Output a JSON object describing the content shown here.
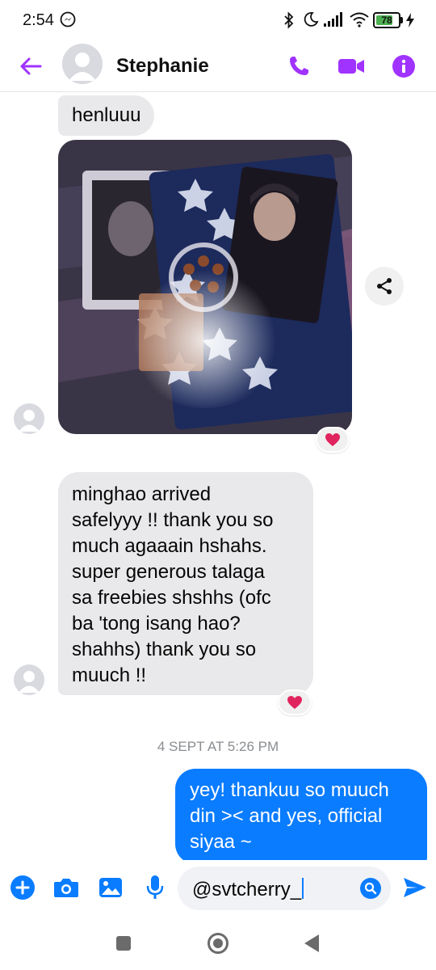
{
  "status_bar": {
    "time": "2:54",
    "battery": "78",
    "battery_level": 0.78
  },
  "header": {
    "contact_name": "Stephanie",
    "accent": "#a033ff"
  },
  "thread": {
    "messages": [
      {
        "direction": "incoming",
        "text": "henluuu"
      },
      {
        "direction": "incoming",
        "type": "photo"
      },
      {
        "direction": "incoming",
        "text": "minghao arrived\nsafelyyy !! thank you so\nmuch agaaain hshahs.\nsuper generous talaga\nsa freebies shshhs (ofc\nba 'tong isang hao?\nshahhs) thank you so\nmuuch !!"
      }
    ],
    "timestamp": "4 SEPT AT 5:26 PM",
    "outgoing": [
      {
        "direction": "outgoing",
        "text": "yey! thankuu so muuch\ndin >< and yes, official\nsiyaa ~"
      }
    ],
    "reactions": [
      "heart",
      "heart"
    ]
  },
  "composer": {
    "input_value": "@svtcherry_",
    "icons": [
      "plus-icon",
      "camera-icon",
      "image-icon",
      "microphone-icon",
      "search-icon",
      "send-icon"
    ],
    "accent": "#0a7cff"
  },
  "nav": {
    "icons": [
      "recents-icon",
      "home-icon",
      "back-icon"
    ]
  }
}
